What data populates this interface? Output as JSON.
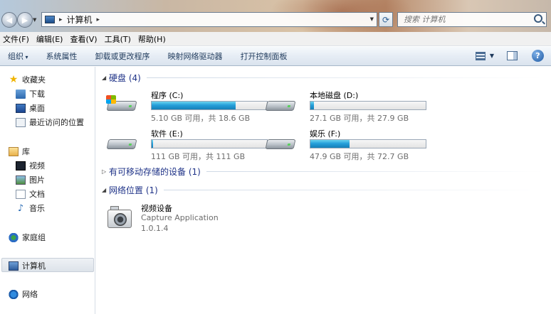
{
  "window": {
    "address": {
      "crumb": "计算机"
    },
    "search": {
      "placeholder": "搜索 计算机"
    }
  },
  "menu": [
    "文件(F)",
    "编辑(E)",
    "查看(V)",
    "工具(T)",
    "帮助(H)"
  ],
  "toolbar": {
    "organize": "组织",
    "items": [
      "系统属性",
      "卸载或更改程序",
      "映射网络驱动器",
      "打开控制面板"
    ]
  },
  "sidebar": {
    "favorites": "收藏夹",
    "favorites_items": [
      "下载",
      "桌面",
      "最近访问的位置"
    ],
    "libraries": "库",
    "libraries_items": [
      "视频",
      "图片",
      "文档",
      "音乐"
    ],
    "homegroup": "家庭组",
    "computer": "计算机",
    "network": "网络"
  },
  "groups": {
    "hard_disks": "硬盘 (4)",
    "removable": "有可移动存储的设备 (1)",
    "network": "网络位置 (1)"
  },
  "drives": [
    {
      "name": "程序 (C:)",
      "info": "5.10 GB 可用，共 18.6 GB",
      "used_fraction": 0.73,
      "system": true
    },
    {
      "name": "本地磁盘 (D:)",
      "info": "27.1 GB 可用，共 27.9 GB",
      "used_fraction": 0.03,
      "system": false
    },
    {
      "name": "软件 (E:)",
      "info": "111 GB 可用，共 111 GB",
      "used_fraction": 0.01,
      "system": false
    },
    {
      "name": "娱乐 (F:)",
      "info": "47.9 GB 可用，共 72.7 GB",
      "used_fraction": 0.34,
      "system": false
    }
  ],
  "device": {
    "name": "视频设备",
    "line2": "Capture Application",
    "line3": "1.0.1.4"
  },
  "colors": {
    "accent": "#1e3287",
    "bar_fill": "#26a0da"
  }
}
